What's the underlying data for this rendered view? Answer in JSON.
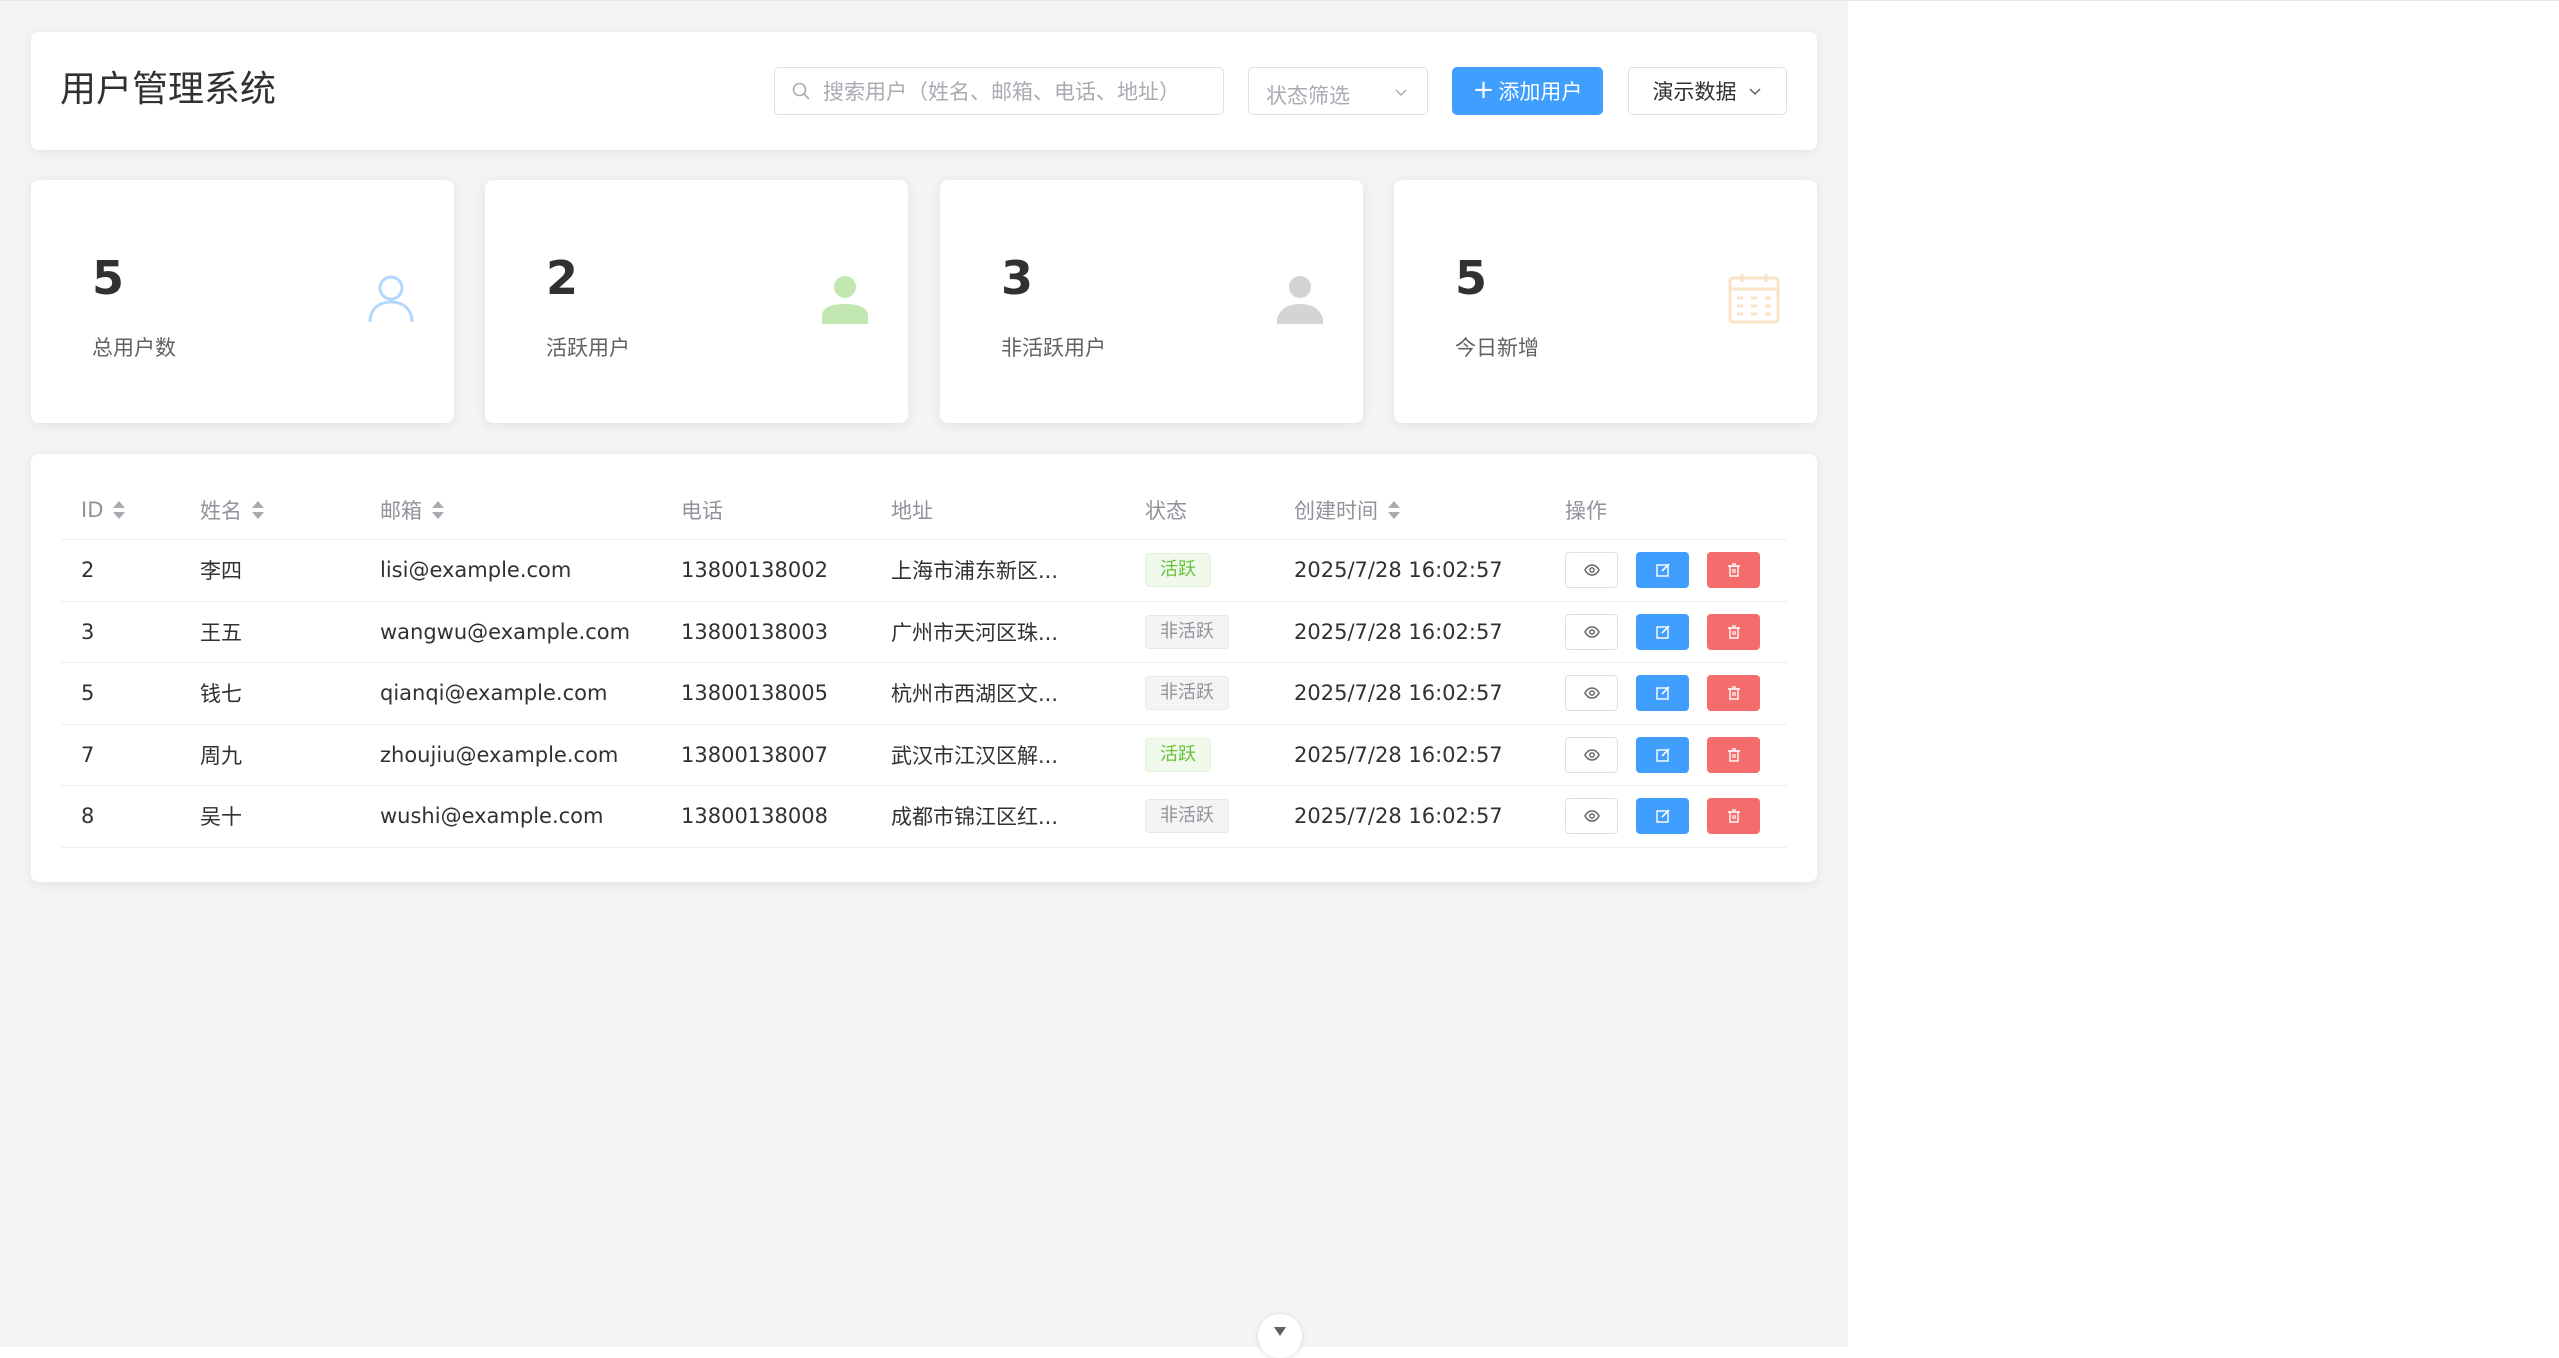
{
  "header": {
    "title": "用户管理系统",
    "search_placeholder": "搜索用户（姓名、邮箱、电话、地址）",
    "status_filter_placeholder": "状态筛选",
    "add_user_label": "添加用户",
    "demo_data_label": "演示数据"
  },
  "stats": [
    {
      "value": "5",
      "label": "总用户数",
      "icon": "user-outline-icon",
      "color": "#b3d8ff"
    },
    {
      "value": "2",
      "label": "活跃用户",
      "icon": "user-filled-icon",
      "color": "#c2e7b0"
    },
    {
      "value": "3",
      "label": "非活跃用户",
      "icon": "user-filled-icon",
      "color": "#d3d4d6"
    },
    {
      "value": "5",
      "label": "今日新增",
      "icon": "calendar-icon",
      "color": "#f8e3c5"
    }
  ],
  "table": {
    "headers": {
      "id": "ID",
      "name": "姓名",
      "email": "邮箱",
      "phone": "电话",
      "address": "地址",
      "status": "状态",
      "created": "创建时间",
      "ops": "操作"
    },
    "rows": [
      {
        "id": "2",
        "name": "李四",
        "email": "lisi@example.com",
        "phone": "13800138002",
        "address": "上海市浦东新区...",
        "status": "活跃",
        "active": true,
        "created": "2025/7/28 16:02:57"
      },
      {
        "id": "3",
        "name": "王五",
        "email": "wangwu@example.com",
        "phone": "13800138003",
        "address": "广州市天河区珠...",
        "status": "非活跃",
        "active": false,
        "created": "2025/7/28 16:02:57"
      },
      {
        "id": "5",
        "name": "钱七",
        "email": "qianqi@example.com",
        "phone": "13800138005",
        "address": "杭州市西湖区文...",
        "status": "非活跃",
        "active": false,
        "created": "2025/7/28 16:02:57"
      },
      {
        "id": "7",
        "name": "周九",
        "email": "zhoujiu@example.com",
        "phone": "13800138007",
        "address": "武汉市江汉区解...",
        "status": "活跃",
        "active": true,
        "created": "2025/7/28 16:02:57"
      },
      {
        "id": "8",
        "name": "吴十",
        "email": "wushi@example.com",
        "phone": "13800138008",
        "address": "成都市锦江区红...",
        "status": "非活跃",
        "active": false,
        "created": "2025/7/28 16:02:57"
      }
    ]
  },
  "colors": {
    "primary": "#409eff",
    "danger": "#f56c6c",
    "success": "#67c23a",
    "info": "#909399"
  }
}
